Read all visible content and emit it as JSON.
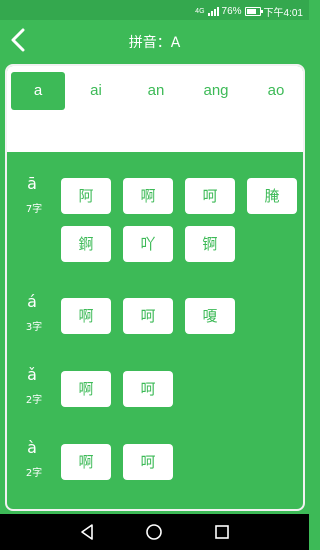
{
  "status": {
    "network": "4G",
    "battery": "76%",
    "time": "下午4:01"
  },
  "header": {
    "title": "拼音：A"
  },
  "tabs": [
    "a",
    "ai",
    "an",
    "ang",
    "ao"
  ],
  "active_tab": 0,
  "groups": [
    {
      "tone": "ā",
      "count": "7字",
      "chars": [
        "阿",
        "啊",
        "呵",
        "腌",
        "錒",
        "吖",
        "锕"
      ]
    },
    {
      "tone": "á",
      "count": "3字",
      "chars": [
        "啊",
        "呵",
        "嗄"
      ]
    },
    {
      "tone": "ǎ",
      "count": "2字",
      "chars": [
        "啊",
        "呵"
      ]
    },
    {
      "tone": "à",
      "count": "2字",
      "chars": [
        "啊",
        "呵"
      ]
    }
  ],
  "colors": {
    "primary": "#3dba57",
    "statusbar": "#34a84e",
    "navbar": "#000000"
  },
  "icons": {
    "back": "chevron-left-icon",
    "nav": [
      "back-triangle-icon",
      "home-circle-icon",
      "recents-square-icon"
    ]
  }
}
